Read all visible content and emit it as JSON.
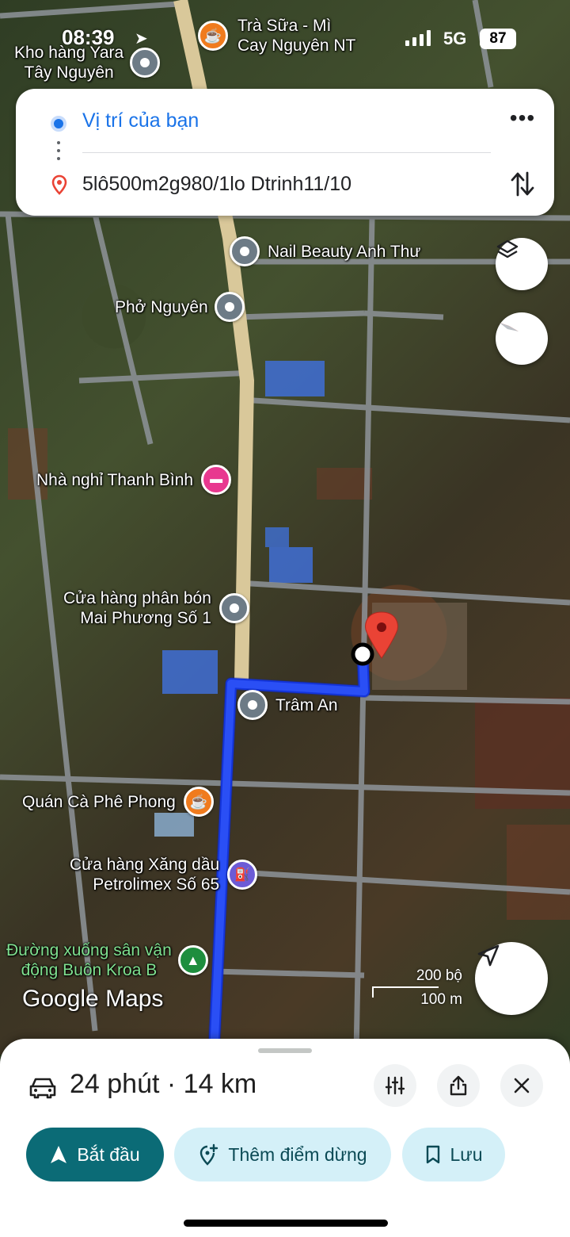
{
  "status_bar": {
    "time": "08:39",
    "network": "5G",
    "battery": "87"
  },
  "directions": {
    "origin": "Vị trí của bạn",
    "destination": "5lô500m2g980/1lo Dtrinh11/10"
  },
  "map": {
    "pois": {
      "kho_hang": "Kho hàng Yara\nTây Nguyên",
      "tra_sua": "Trà Sữa - Mì\nCay Nguyên NT",
      "nail": "Nail Beauty Anh Thư",
      "pho": "Phở Nguyên",
      "nha_nghi": "Nhà nghỉ Thanh Bình",
      "cua_hang_phan_bon": "Cửa hàng phân bón\nMai Phương Số 1",
      "tram_an": "Trâm An",
      "quan_ca_phe": "Quán Cà Phê Phong",
      "xang_dau": "Cửa hàng Xăng dầu\nPetrolimex Số 65",
      "duong_xuong": "Đường xuống sân vận\nđộng Buôn Kroa B"
    },
    "scale": {
      "imperial": "200 bộ",
      "metric": "100 m"
    },
    "watermark": "Google Maps"
  },
  "sheet": {
    "summary": "24 phút · 14 km",
    "start_label": "Bắt đầu",
    "add_stop_label": "Thêm điểm dừng",
    "save_label": "Lưu"
  },
  "colors": {
    "route": "#1a3ff2",
    "primary": "#0b6b76",
    "secondary": "#d4f0f8",
    "destination_pin": "#ea4335"
  }
}
